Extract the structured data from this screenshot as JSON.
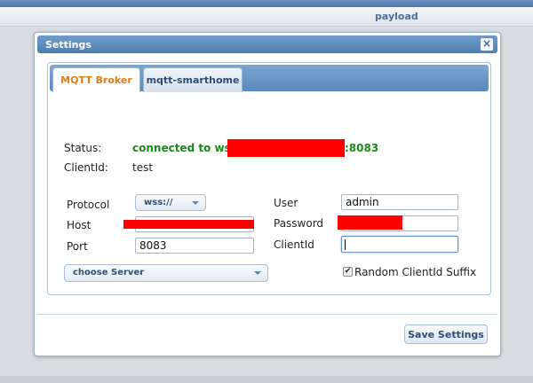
{
  "background": {
    "column_header": "payload"
  },
  "dialog": {
    "title": "Settings",
    "close_glyph": "×",
    "tabs": [
      {
        "label": "MQTT Broker",
        "active": true
      },
      {
        "label": "mqtt-smarthome",
        "active": false
      }
    ],
    "status": {
      "label": "Status:",
      "prefix": "connected to wss://",
      "suffix": ":8083",
      "color": "#1a8a1a"
    },
    "client_info": {
      "label": "ClientId:",
      "value": "test"
    },
    "form": {
      "protocol_label": "Protocol",
      "protocol_value": "wss://",
      "host_label": "Host",
      "host_value": "",
      "port_label": "Port",
      "port_value": "8083",
      "user_label": "User",
      "user_value": "admin",
      "password_label": "Password",
      "password_value": "",
      "clientid_label": "ClientId",
      "clientid_value": "",
      "server_select": "choose Server",
      "random_suffix_label": "Random ClientId Suffix",
      "random_suffix_checked": true
    },
    "save_label": "Save Settings",
    "redaction_color": "#ff0000",
    "accent_color": "#e07d14"
  }
}
